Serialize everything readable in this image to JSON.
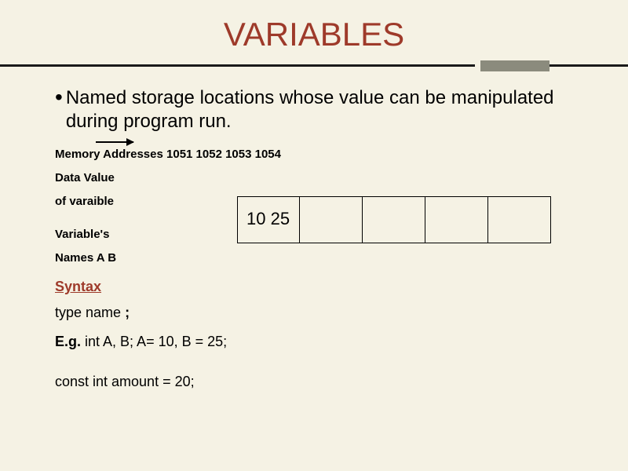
{
  "title": "VARIABLES",
  "bullet": "Named storage locations whose value can be manipulated during program run.",
  "mem": {
    "label": "Memory Addresses",
    "addresses": "1051 1052 1053 1054"
  },
  "data_label_line1": "Data Value",
  "data_label_line2": "of varaible",
  "values": "10 25",
  "variables_s": "Variable's",
  "names_line": "Names A B",
  "syntax": "Syntax",
  "type_name": "type name",
  "semicolon": ";",
  "eg_prefix": "E.g.",
  "eg_body": " int A, B; A= 10, B = 25;",
  "const_line": "const int amount = 20;"
}
